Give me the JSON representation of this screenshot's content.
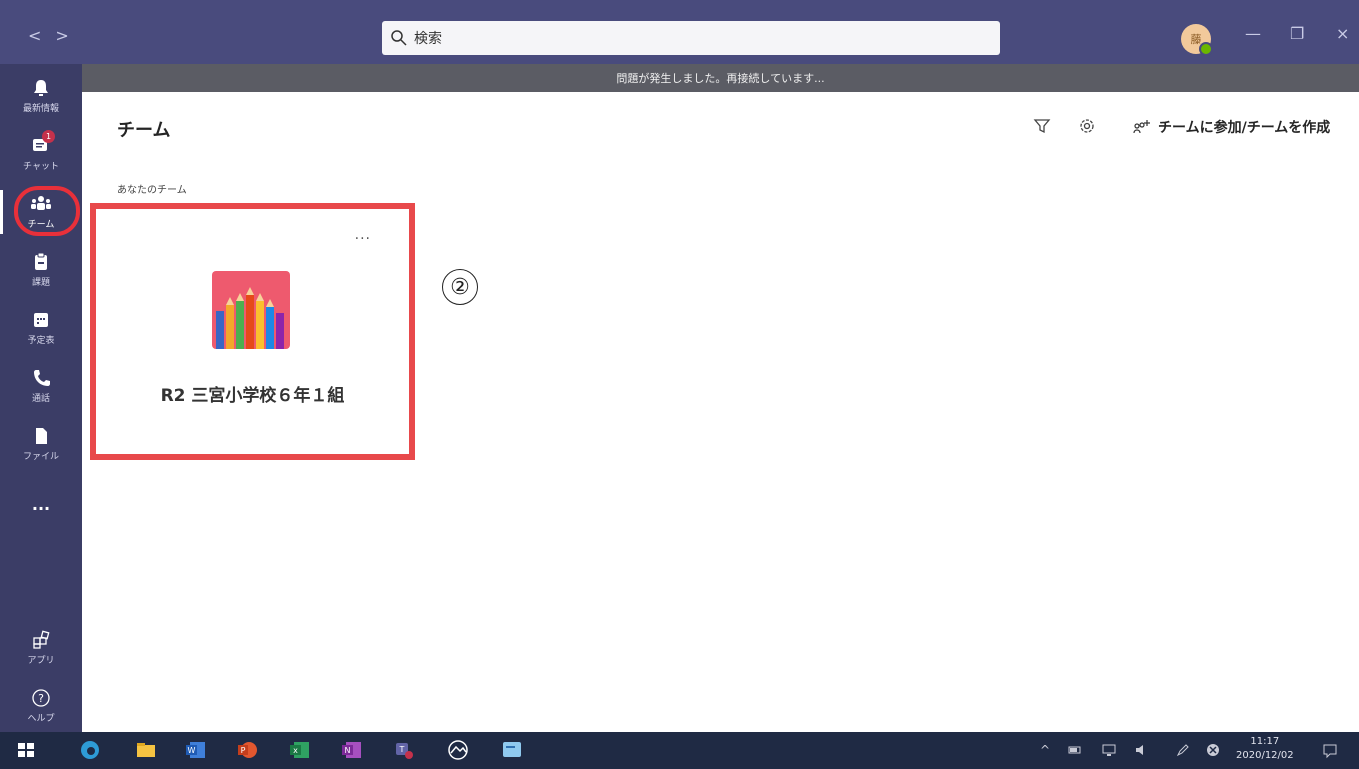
{
  "titlebar": {
    "back": "<",
    "forward": ">",
    "search_placeholder": "検索",
    "avatar_initial": "藤",
    "minimize": "—",
    "maximize": "❐",
    "close": "×"
  },
  "banner": {
    "text": "問題が発生しました。再接続しています..."
  },
  "rail": {
    "items": [
      {
        "label": "最新情報",
        "icon": "bell-icon"
      },
      {
        "label": "チャット",
        "icon": "chat-icon",
        "badge": "1"
      },
      {
        "label": "チーム",
        "icon": "teams-icon",
        "active": true
      },
      {
        "label": "課題",
        "icon": "assignments-icon"
      },
      {
        "label": "予定表",
        "icon": "calendar-icon"
      },
      {
        "label": "通話",
        "icon": "phone-icon"
      },
      {
        "label": "ファイル",
        "icon": "file-icon"
      },
      {
        "label": "...",
        "icon": "more-icon"
      },
      {
        "label": "アプリ",
        "icon": "apps-icon"
      },
      {
        "label": "ヘルプ",
        "icon": "help-icon"
      }
    ]
  },
  "main": {
    "title": "チーム",
    "join_create": "チームに参加/チームを作成",
    "section_label": "あなたのチーム",
    "team_card": {
      "more": "···",
      "name": "R2 三宮小学校６年１組"
    },
    "step_marker": "②"
  },
  "taskbar": {
    "time": "11:17",
    "date": "2020/12/02",
    "tray_up": "^"
  },
  "colors": {
    "titlebar": "#494b7d",
    "rail": "#3b3d66",
    "highlight": "#e8494b",
    "taskbar": "#1f2a44"
  }
}
